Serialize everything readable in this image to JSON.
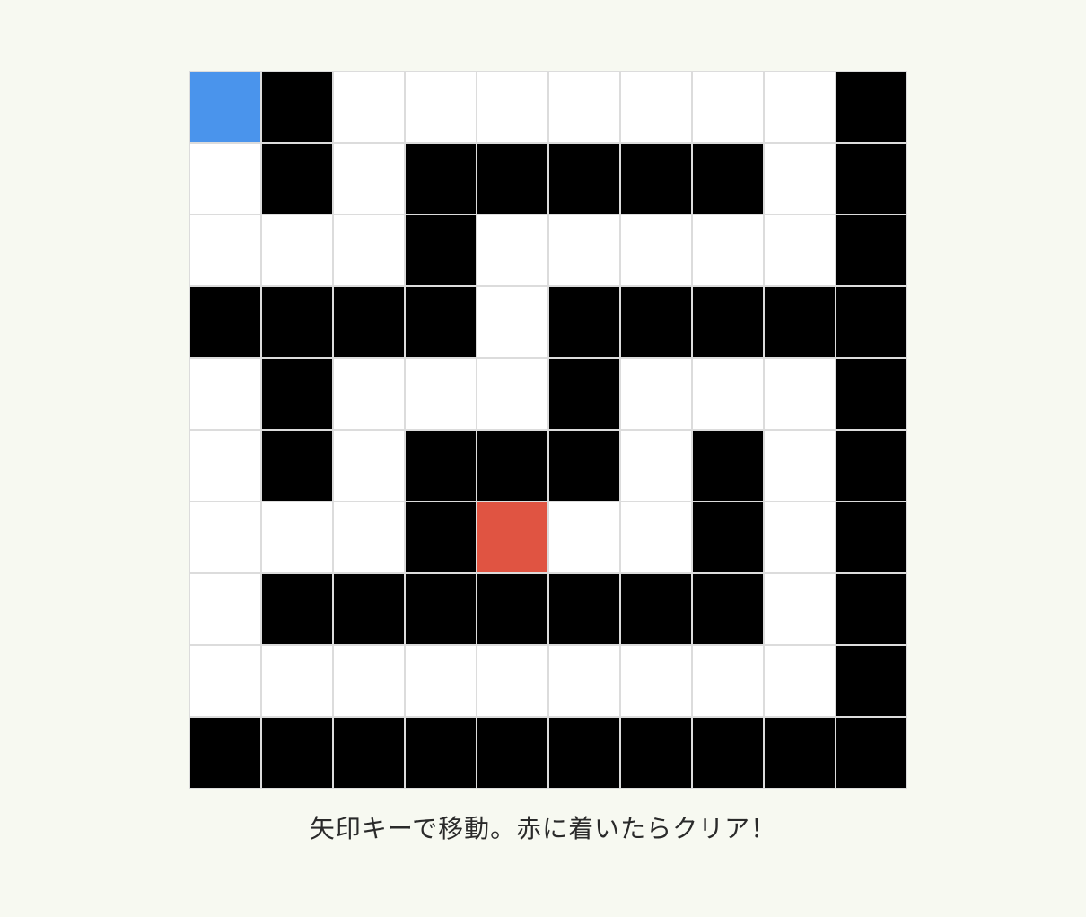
{
  "game": {
    "rows": [
      "PW.......W",
      ".W.WWWWW.W",
      "...W.....W",
      "WWWW.WWWWW",
      ".W...W...W",
      ".W.WWW.W.W",
      "...WG..W.W",
      ".WWWWWWW.W",
      ".........W",
      "WWWWWWWWWW"
    ],
    "legend": {
      "P": "player",
      "G": "goal",
      "W": "wall",
      ".": "path"
    },
    "colors": {
      "path": "#ffffff",
      "wall": "#000000",
      "player": "#4a94ec",
      "goal": "#e05442",
      "grid_line": "#dcdcdc",
      "background": "#f7f9f1"
    }
  },
  "instruction": "矢印キーで移動。赤に着いたらクリア！"
}
